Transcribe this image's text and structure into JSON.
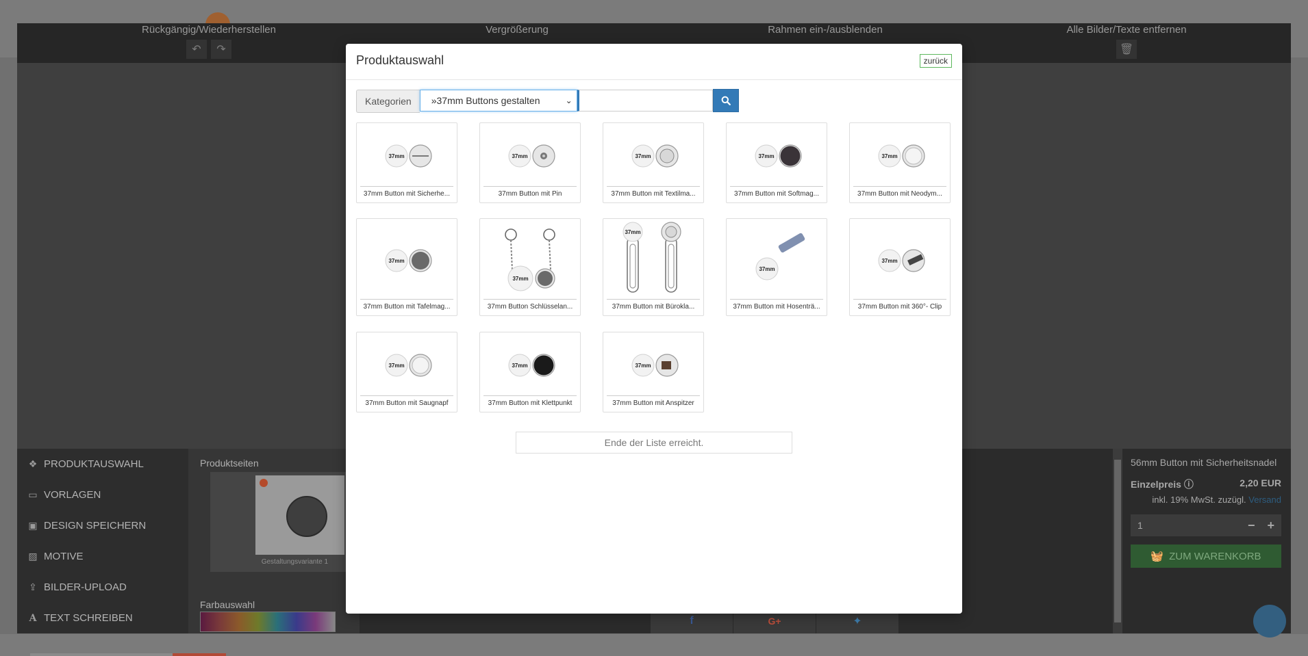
{
  "toolbar": {
    "undo_redo_label": "Rückgängig/Wiederherstellen",
    "zoom_label": "Vergrößerung",
    "frame_label": "Rahmen ein-/ausblenden",
    "remove_all_label": "Alle Bilder/Texte entfernen"
  },
  "side_menu": {
    "items": [
      {
        "label": "PRODUKTAUSWAHL",
        "icon": "cubes-icon"
      },
      {
        "label": "VORLAGEN",
        "icon": "folder-open-icon"
      },
      {
        "label": "DESIGN SPEICHERN",
        "icon": "floppy-disk-icon"
      },
      {
        "label": "MOTIVE",
        "icon": "image-icon"
      },
      {
        "label": "BILDER-UPLOAD",
        "icon": "upload-icon"
      },
      {
        "label": "TEXT SCHREIBEN",
        "icon": "font-icon"
      }
    ]
  },
  "pages_panel": {
    "title": "Produktseiten",
    "thumb_caption": "Gestaltungsvariante 1",
    "color_title": "Farbauswahl"
  },
  "right_panel": {
    "product_title": "56mm Button mit Sicherheitsnadel",
    "price_label": "Einzelpreis",
    "price_value": "2,20 EUR",
    "tax_text": "inkl. 19% MwSt. zuzügl.",
    "shipping_link": "Versand",
    "quantity": "1",
    "cart_label": "ZUM WARENKORB"
  },
  "modal": {
    "title": "Produktauswahl",
    "back_label": "zurück",
    "category_label": "Kategorien",
    "category_value": "»37mm Buttons gestalten",
    "search_value": "",
    "search_placeholder": "",
    "products": [
      {
        "label": "37mm Button mit Sicherhe...",
        "back": "safety-pin"
      },
      {
        "label": "37mm Button mit Pin",
        "back": "pin"
      },
      {
        "label": "37mm Button mit Textilma...",
        "back": "textile-magnet"
      },
      {
        "label": "37mm Button mit Softmag...",
        "back": "soft-magnet"
      },
      {
        "label": "37mm Button mit Neodym...",
        "back": "neodym-magnet"
      },
      {
        "label": "37mm Button mit Tafelmag...",
        "back": "board-magnet"
      },
      {
        "label": "37mm Button Schlüsselan...",
        "back": "keychain"
      },
      {
        "label": "37mm Button mit Bürokla...",
        "back": "paper-clip"
      },
      {
        "label": "37mm Button mit Hosenträ...",
        "back": "suspender-clip"
      },
      {
        "label": "37mm Button mit 360°- Clip",
        "back": "clip-360"
      },
      {
        "label": "37mm Button mit Saugnapf",
        "back": "suction-cup"
      },
      {
        "label": "37mm Button mit Klettpunkt",
        "back": "velcro-dot"
      },
      {
        "label": "37mm Button mit Anspitzer",
        "back": "sharpener"
      }
    ],
    "badge_text": "37mm",
    "end_note": "Ende der Liste erreicht."
  },
  "colors": {
    "accent": "#337ab7",
    "cart_green": "#2f5b32",
    "back_border": "#5cb85c"
  }
}
